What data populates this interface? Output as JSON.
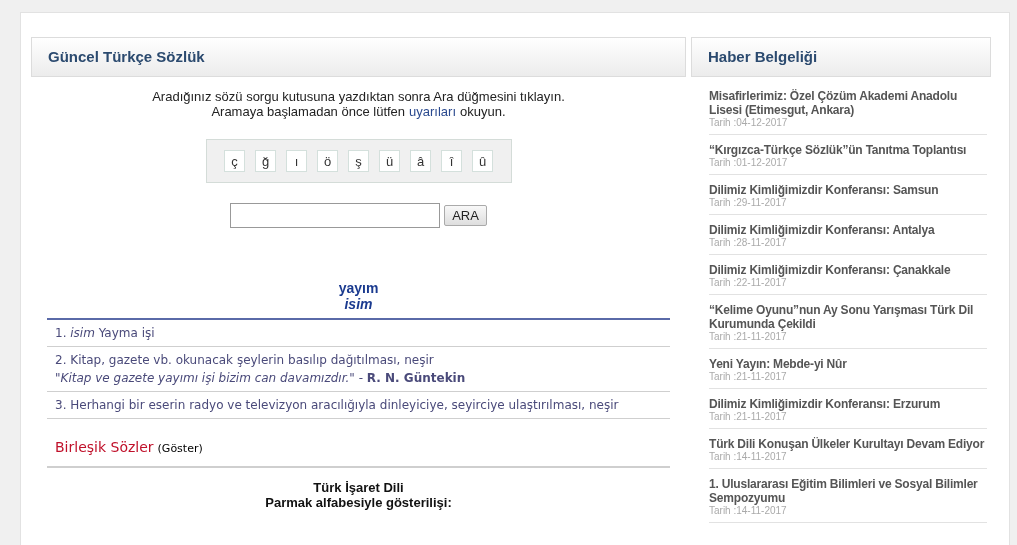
{
  "dictionary": {
    "title": "Güncel Türkçe Sözlük",
    "instruction_line": "Aradığınız sözü sorgu kutusuna yazdıktan sonra Ara düğmesini tıklayın.",
    "warning_line": {
      "before": "Aramaya başlamadan önce lütfen",
      "link": "uyarıları",
      "after": "okuyun."
    },
    "special_chars": [
      "ç",
      "ğ",
      "ı",
      "ö",
      "ş",
      "ü",
      "â",
      "î",
      "û"
    ],
    "search": {
      "button": "ARA"
    },
    "entry": {
      "word": "yayım",
      "type": "isim"
    },
    "meanings": [
      {
        "text": "1. *isim* Yayma işi"
      },
      {
        "text": "2. Kitap, gazete vb. okunacak şeylerin basılıp dağıtılması, neşir",
        "example": "\"*Kitap ve gazete yayımı işi bizim can davamızdır.*\" - **R. N. Güntekin**"
      },
      {
        "text": "3. Herhangi bir eserin radyo ve televizyon aracılığıyla dinleyiciye, seyirciye ulaştırılması, neşir"
      }
    ],
    "compounds": {
      "title": "Birleşik Sözler",
      "toggle": "(Göster)"
    },
    "sign_language": {
      "title": "Türk İşaret Dili",
      "subtitle": "Parmak alfabesiyle gösterilişi:"
    }
  },
  "news": {
    "title": "Haber Belgeliği",
    "items": [
      {
        "title": "Misafirlerimiz: Özel Çözüm Akademi Anadolu Lisesi (Etimesgut, Ankara)",
        "date": "Tarih :04-12-2017"
      },
      {
        "title": "“Kırgızca-Türkçe Sözlük”ün Tanıtma Toplantısı",
        "date": "Tarih :01-12-2017"
      },
      {
        "title": "Dilimiz Kimliğimizdir Konferansı: Samsun",
        "date": "Tarih :29-11-2017"
      },
      {
        "title": "Dilimiz Kimliğimizdir Konferansı: Antalya",
        "date": "Tarih :28-11-2017"
      },
      {
        "title": "Dilimiz Kimliğimizdir Konferansı: Çanakkale",
        "date": "Tarih :22-11-2017"
      },
      {
        "title": "“Kelime Oyunu”nun Ay Sonu Yarışması Türk Dil Kurumunda Çekildi",
        "date": "Tarih :21-11-2017"
      },
      {
        "title": "Yeni Yayın: Mebde-yi Nûr",
        "date": "Tarih :21-11-2017"
      },
      {
        "title": "Dilimiz Kimliğimizdir Konferansı: Erzurum",
        "date": "Tarih :21-11-2017"
      },
      {
        "title": "Türk Dili Konuşan Ülkeler Kurultayı Devam Ediyor",
        "date": "Tarih :14-11-2017"
      },
      {
        "title": "1. Uluslararası Eğitim Bilimleri ve Sosyal Bilimler Sempozyumu",
        "date": "Tarih :14-11-2017"
      }
    ]
  }
}
